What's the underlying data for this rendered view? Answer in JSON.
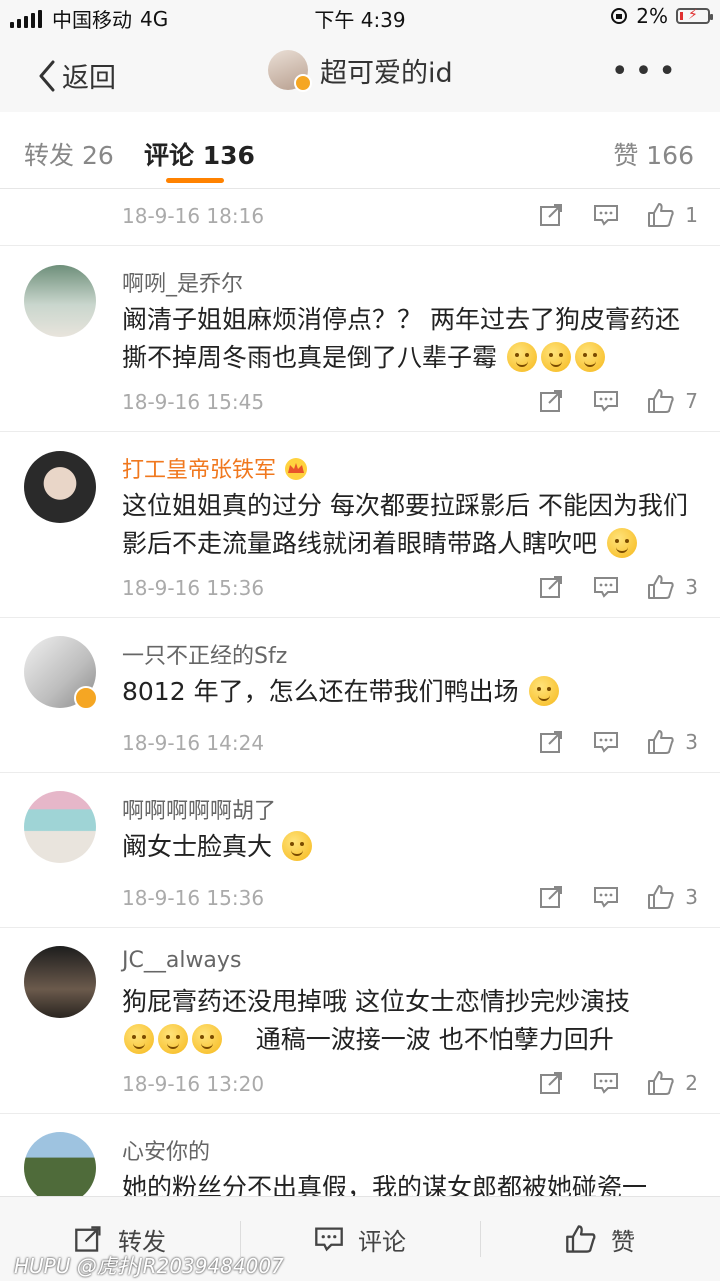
{
  "status": {
    "carrier": "中国移动",
    "network": "4G",
    "time": "下午 4:39",
    "battery": "2%"
  },
  "nav": {
    "back_label": "返回",
    "title": "超可爱的id",
    "more": "•••"
  },
  "tabs": [
    {
      "label": "转发 26"
    },
    {
      "label": "评论 136",
      "active": true
    },
    {
      "label": "赞 166"
    }
  ],
  "comments": [
    {
      "name": "",
      "text": "",
      "time": "18-9-16 18:16",
      "likes": "1"
    },
    {
      "name": "啊咧_是乔尔",
      "text": "阚清子姐姐麻烦消停点？？ 两年过去了狗皮膏药还撕不掉周冬雨也真是倒了八辈子霉",
      "time": "18-9-16 15:45",
      "likes": "7"
    },
    {
      "name": "打工皇帝张铁军",
      "text": "这位姐姐真的过分 每次都要拉踩影后 不能因为我们影后不走流量路线就闭着眼睛带路人瞎吹吧",
      "time": "18-9-16 15:36",
      "likes": "3"
    },
    {
      "name": "一只不正经的Sfz",
      "text": "8012 年了，怎么还在带我们鸭出场",
      "time": "18-9-16 14:24",
      "likes": "3"
    },
    {
      "name": "啊啊啊啊啊胡了",
      "text": "阚女士脸真大",
      "time": "18-9-16 15:36",
      "likes": "3"
    },
    {
      "name": "JC__always",
      "text": "狗屁膏药还没甩掉哦  这位女士恋情抄完炒演技",
      "text2": "通稿一波接一波  也不怕孽力回升",
      "time": "18-9-16 13:20",
      "likes": "2"
    },
    {
      "name": "心安你的",
      "text": "她的粉丝分不出真假，我的谋女郎都被她碰瓷一"
    }
  ],
  "bottom": {
    "repost": "转发",
    "comment": "评论",
    "like": "赞"
  },
  "watermark": "HUPU @虎扑JR2039484007",
  "colors": {
    "accent": "#ff8200",
    "vip_name": "#f0781e"
  }
}
